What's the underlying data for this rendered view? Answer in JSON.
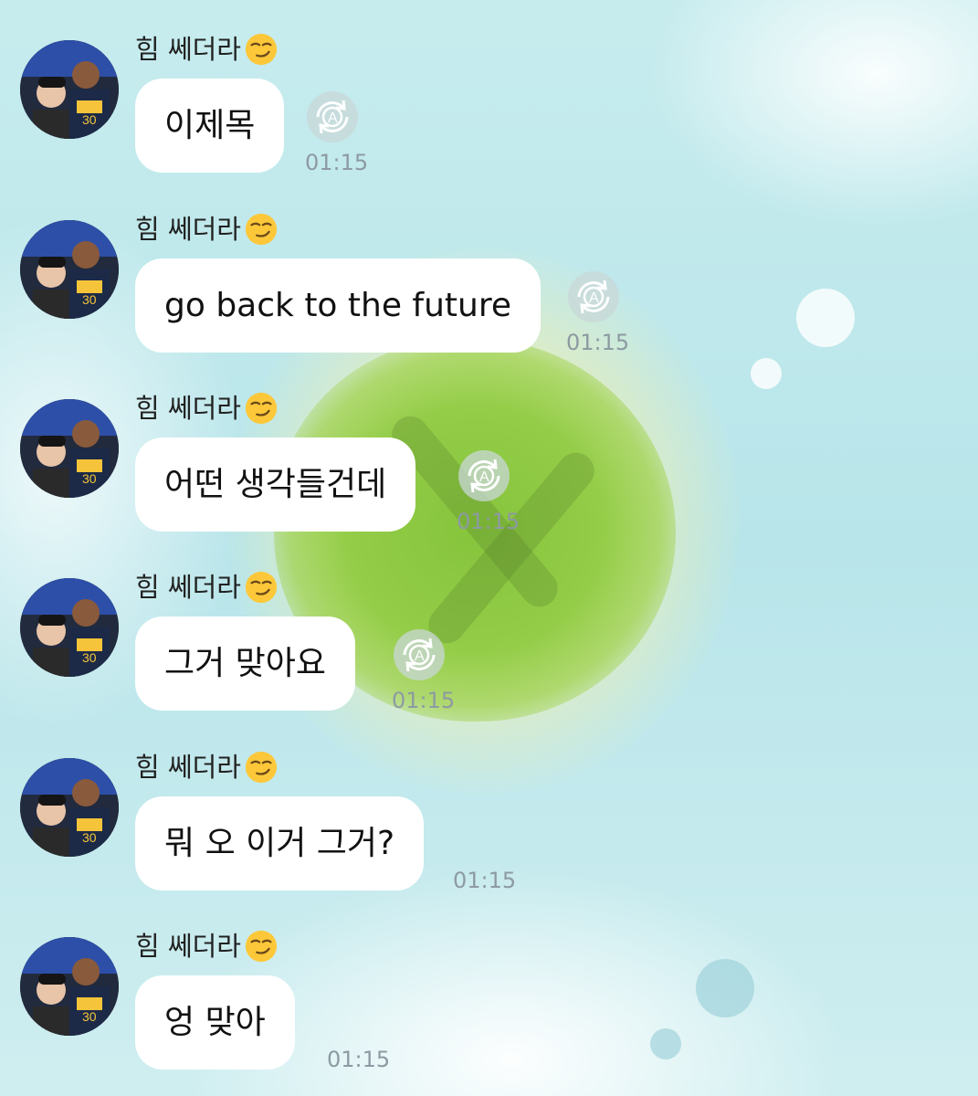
{
  "chat": {
    "messages": [
      {
        "sender": "힘 쎄더라",
        "sender_emoji": "smirk-face-icon",
        "text": "이제목",
        "time": "01:15",
        "read_icon": "refresh-a-icon"
      },
      {
        "sender": "힘 쎄더라",
        "sender_emoji": "smirk-face-icon",
        "text": "go back to the future",
        "time": "01:15",
        "read_icon": "refresh-a-icon"
      },
      {
        "sender": "힘 쎄더라",
        "sender_emoji": "smirk-face-icon",
        "text": "어떤 생각들건데",
        "time": "01:15",
        "read_icon": "refresh-a-icon"
      },
      {
        "sender": "힘 쎄더라",
        "sender_emoji": "smirk-face-icon",
        "text": "그거 맞아요",
        "time": "01:15",
        "read_icon": "refresh-a-icon"
      },
      {
        "sender": "힘 쎄더라",
        "sender_emoji": "smirk-face-icon",
        "text": "뭐 오 이거 그거?",
        "time": "01:15"
      },
      {
        "sender": "힘 쎄더라",
        "sender_emoji": "smirk-face-icon",
        "text": "엉 맞아",
        "time": "01:15"
      }
    ]
  },
  "colors": {
    "bubble": "#ffffff",
    "time_text": "#8d9aa2",
    "background": "#bfe6ea"
  }
}
